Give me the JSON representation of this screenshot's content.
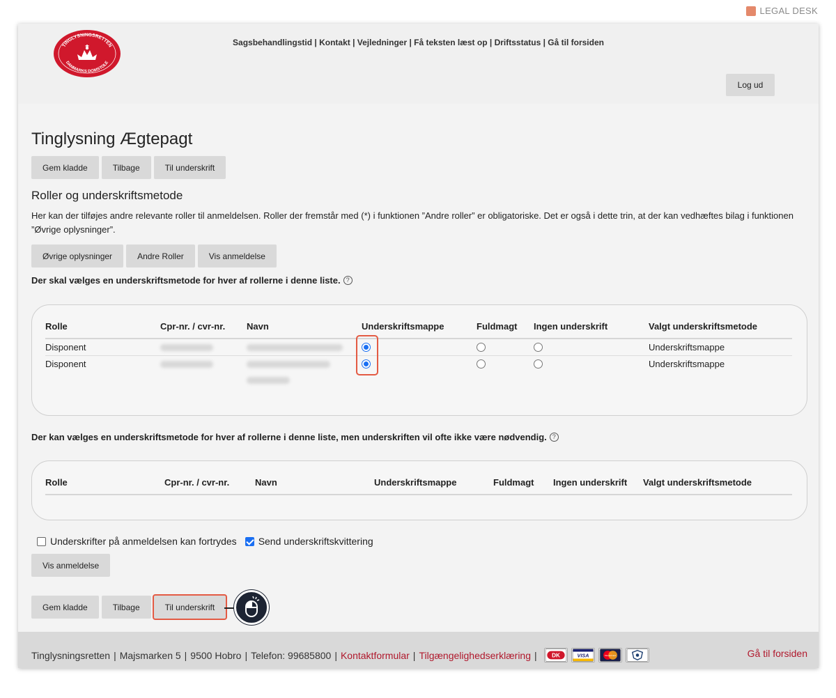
{
  "watermark": "LEGAL DESK",
  "header": {
    "seal_top_text": "TINGLYSNINGSRETTEN",
    "seal_bottom_text": "DANMARKS DOMSTOLE",
    "nav": [
      "Sagsbehandlingstid",
      "Kontakt",
      "Vejledninger",
      "Få teksten læst op",
      "Driftsstatus",
      "Gå til forsiden"
    ],
    "logout_label": "Log ud"
  },
  "page": {
    "title": "Tinglysning Ægtepagt",
    "buttons_top": [
      "Gem kladde",
      "Tilbage",
      "Til underskrift"
    ],
    "section_title": "Roller og underskriftsmetode",
    "description": "Her kan der tilføjes andre relevante roller til anmeldelsen. Roller der fremstår med (*) i funktionen ”Andre roller” er obligatoriske. Det er også i dette trin, at der kan vedhæftes bilag i funktionen ”Øvrige oplysninger”.",
    "buttons_mid": [
      "Øvrige oplysninger",
      "Andre Roller",
      "Vis anmeldelse"
    ]
  },
  "required_list": {
    "instruction": "Der skal vælges en underskriftsmetode for hver af rollerne i denne liste.",
    "columns": [
      "Rolle",
      "Cpr-nr. / cvr-nr.",
      "Navn",
      "Underskriftsmappe",
      "Fuldmagt",
      "Ingen underskrift",
      "Valgt underskriftsmetode"
    ],
    "rows": [
      {
        "rolle": "Disponent",
        "valgt": "Underskriftsmappe",
        "selected": "Underskriftsmappe"
      },
      {
        "rolle": "Disponent",
        "valgt": "Underskriftsmappe",
        "selected": "Underskriftsmappe"
      }
    ]
  },
  "optional_list": {
    "instruction": "Der kan vælges en underskriftsmetode for hver af rollerne i denne liste, men underskriften vil ofte ikke være nødvendig.",
    "columns": [
      "Rolle",
      "Cpr-nr. / cvr-nr.",
      "Navn",
      "Underskriftsmappe",
      "Fuldmagt",
      "Ingen underskrift",
      "Valgt underskriftsmetode"
    ]
  },
  "options": {
    "revocable_label": "Underskrifter på anmeldelsen kan fortrydes",
    "revocable_checked": false,
    "receipt_label": "Send underskriftskvittering",
    "receipt_checked": true
  },
  "bottom": {
    "vis_label": "Vis anmeldelse",
    "buttons": [
      "Gem kladde",
      "Tilbage",
      "Til underskrift"
    ]
  },
  "footer": {
    "name": "Tinglysningsretten",
    "address": "Majsmarken 5",
    "city": "9500 Hobro",
    "phone": "Telefon: 99685800",
    "contact_link": "Kontaktformular",
    "access_link": "Tilgængelighedserklæring",
    "cards": [
      "DK",
      "VISA",
      "MasterCard"
    ],
    "home_link": "Gå til forsiden"
  },
  "colors": {
    "accent_link": "#b0182c",
    "highlight": "#e35a43",
    "radio_blue": "#1a6ff2",
    "seal_red": "#d0182c"
  }
}
